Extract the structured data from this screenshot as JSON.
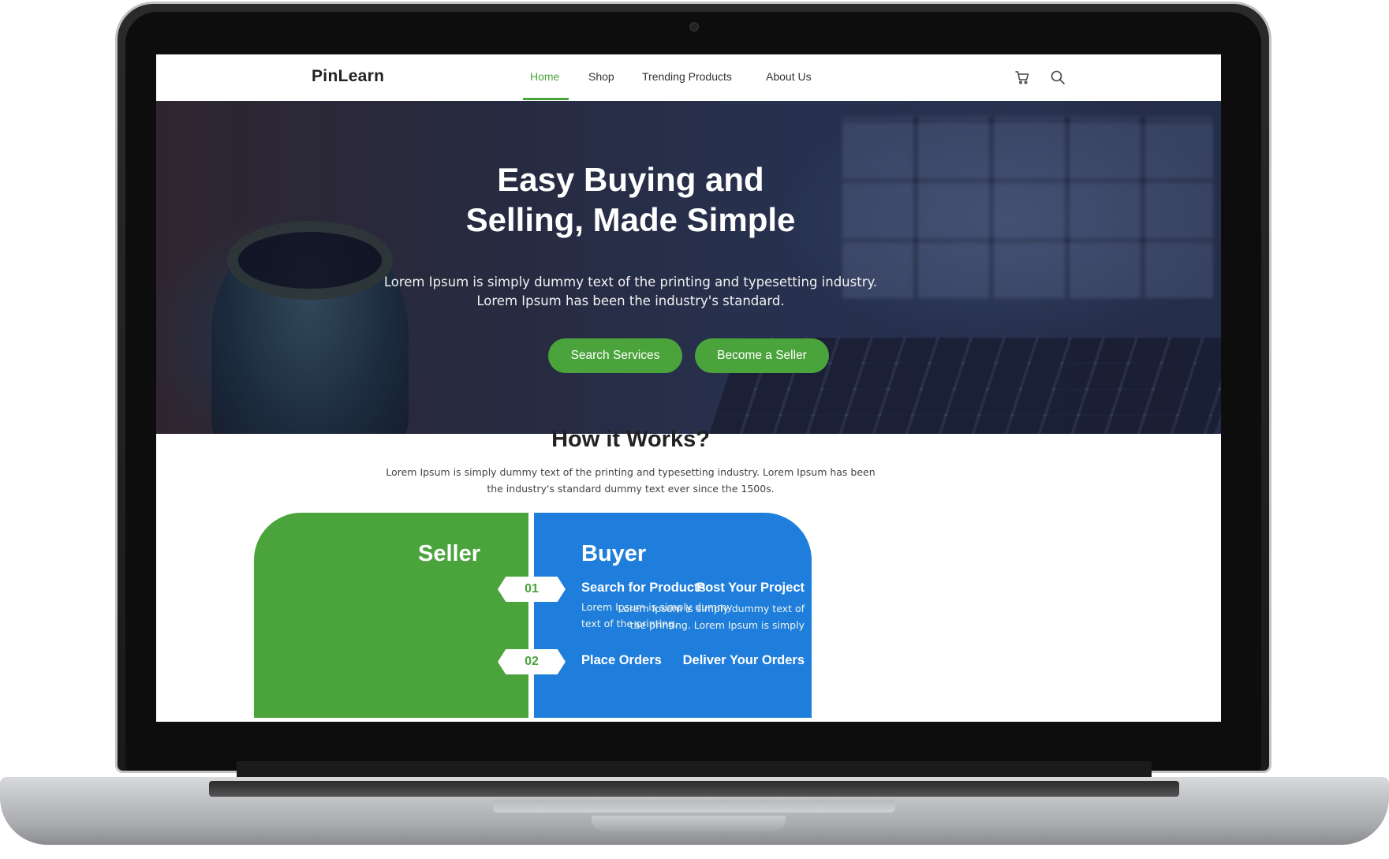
{
  "nav": {
    "logo": "PinLearn",
    "items": [
      {
        "label": "Home",
        "active": true
      },
      {
        "label": "Shop",
        "active": false
      },
      {
        "label": "Trending Products",
        "active": false
      },
      {
        "label": "About Us",
        "active": false
      }
    ],
    "icons": [
      "cart-icon",
      "search-icon"
    ]
  },
  "hero": {
    "title_line1": "Easy Buying and",
    "title_line2": "Selling, Made Simple",
    "subtitle_line1": "Lorem Ipsum is simply dummy text of the printing and typesetting industry.",
    "subtitle_line2": "Lorem Ipsum has been the industry's standard.",
    "buttons": [
      "Search Services",
      "Become a Seller"
    ]
  },
  "how": {
    "title": "How it Works?",
    "subtitle_line1": "Lorem Ipsum is simply dummy text of the printing and typesetting industry. Lorem Ipsum has been",
    "subtitle_line2": "the industry's standard dummy text ever since the 1500s.",
    "seller": {
      "heading": "Seller",
      "steps": [
        {
          "title": "Post Your Project",
          "text_line1": "Lorem Ipsum is simply dummy text of",
          "text_line2": "the printing. Lorem Ipsum is simply"
        },
        {
          "title": "Deliver Your Orders"
        }
      ]
    },
    "buyer": {
      "heading": "Buyer",
      "steps": [
        {
          "title": "Search for Products",
          "text_line1": "Lorem Ipsum is simply dummy",
          "text_line2": "text of the printing."
        },
        {
          "title": "Place Orders"
        }
      ]
    },
    "badges": [
      "01",
      "02"
    ]
  },
  "colors": {
    "accent_green": "#4aa33b",
    "accent_blue": "#1f7edb",
    "text_dark": "#222222"
  }
}
